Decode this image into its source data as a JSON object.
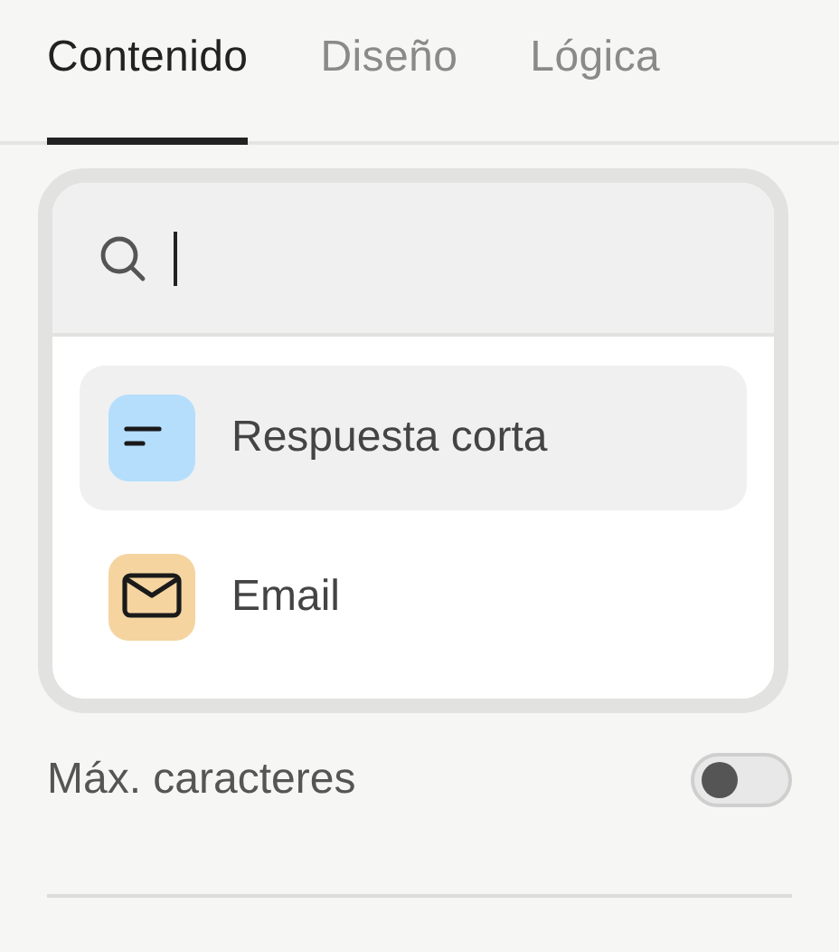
{
  "tabs": [
    {
      "label": "Contenido",
      "selected": true
    },
    {
      "label": "Diseño",
      "selected": false
    },
    {
      "label": "Lógica",
      "selected": false
    }
  ],
  "dropdown": {
    "items": [
      {
        "kind": "short-text",
        "label": "Respuesta corta",
        "selected": true
      },
      {
        "kind": "email",
        "label": "Email",
        "selected": false
      }
    ]
  },
  "settings": [
    {
      "label": "Máx. caracteres",
      "on": false
    }
  ]
}
